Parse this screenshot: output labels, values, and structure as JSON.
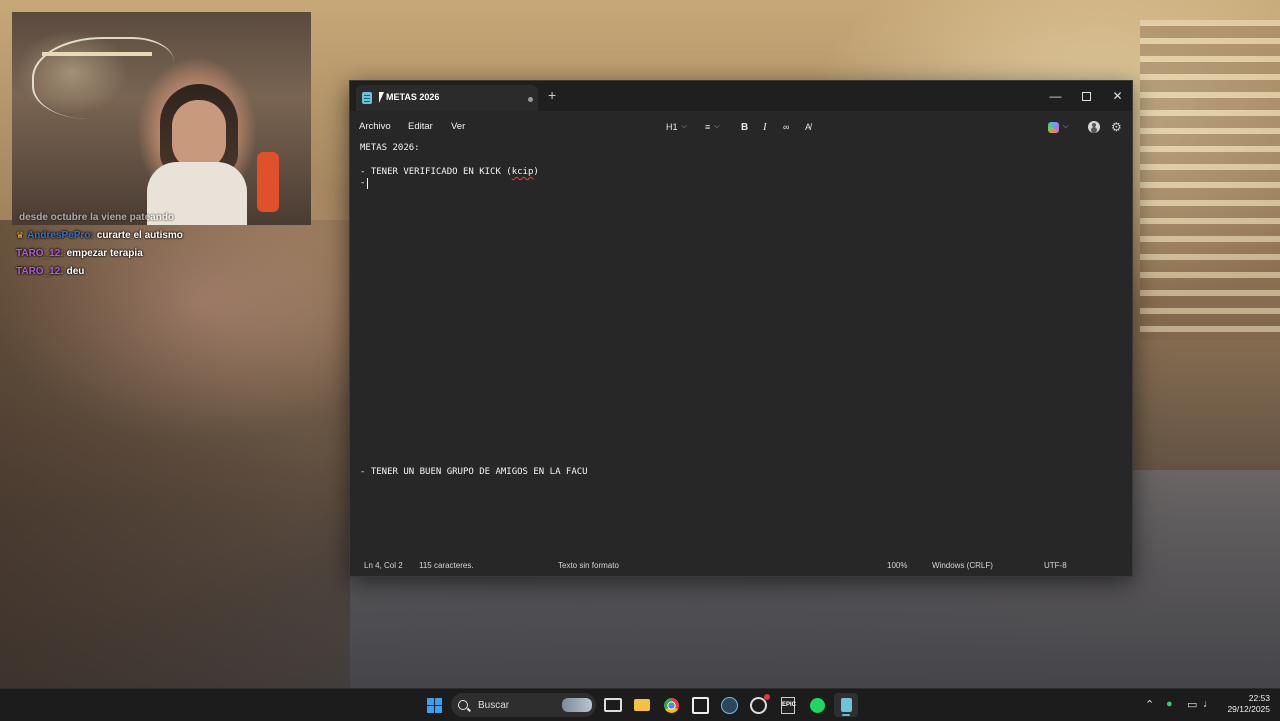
{
  "chat": [
    {
      "user": "",
      "message": "desde octubre la viene pateando",
      "faded": true
    },
    {
      "user": "AndresPePro:",
      "message": "curarte el autismo",
      "user_color": "#2f72d8",
      "badge": "♛"
    },
    {
      "user": "TARO_12:",
      "message": "empezar terapia",
      "user_color": "#b25adf"
    },
    {
      "user": "TARO_12:",
      "message": "deu",
      "user_color": "#b25adf"
    }
  ],
  "notepad": {
    "tab_title": "METAS 2026",
    "new_tab": "+",
    "window_controls": {
      "minimize": "—",
      "close": "✕"
    },
    "menu": [
      "Archivo",
      "Editar",
      "Ver"
    ],
    "toolbar": {
      "heading": "H1",
      "list_icon": "list-icon",
      "bold": "B",
      "italic": "I",
      "link_icon": "link-icon",
      "clear_format_icon": "clear-formatting-icon",
      "copilot_icon": "copilot-icon",
      "account_icon": "account-icon",
      "settings_icon": "gear-icon"
    },
    "content": {
      "line1": "METAS 2026:",
      "line2_prefix": "- TENER VERIFICADO EN KICK (",
      "line2_misspelled": "kcip",
      "line2_suffix": ")",
      "line3": "-",
      "line4": "- TENER UN BUEN GRUPO DE AMIGOS EN LA FACU"
    },
    "status": {
      "position": "Ln 4, Col 2",
      "chars": "115 caracteres.",
      "format": "Texto sin formato",
      "zoom": "100%",
      "line_endings": "Windows (CRLF)",
      "encoding": "UTF-8"
    }
  },
  "taskbar": {
    "search_placeholder": "Buscar",
    "apps": [
      "start-icon",
      "task-view-icon",
      "file-explorer-icon",
      "chrome-icon",
      "capcut-icon",
      "steam-icon",
      "recorder-icon",
      "epic-games-icon",
      "spotify-icon",
      "notepad-icon"
    ],
    "clock_time": "22:53",
    "clock_date": "29/12/2025"
  },
  "colors": {
    "accent": "#3aa0f0",
    "window_bg": "#272727",
    "spell_error": "#e0443e"
  }
}
